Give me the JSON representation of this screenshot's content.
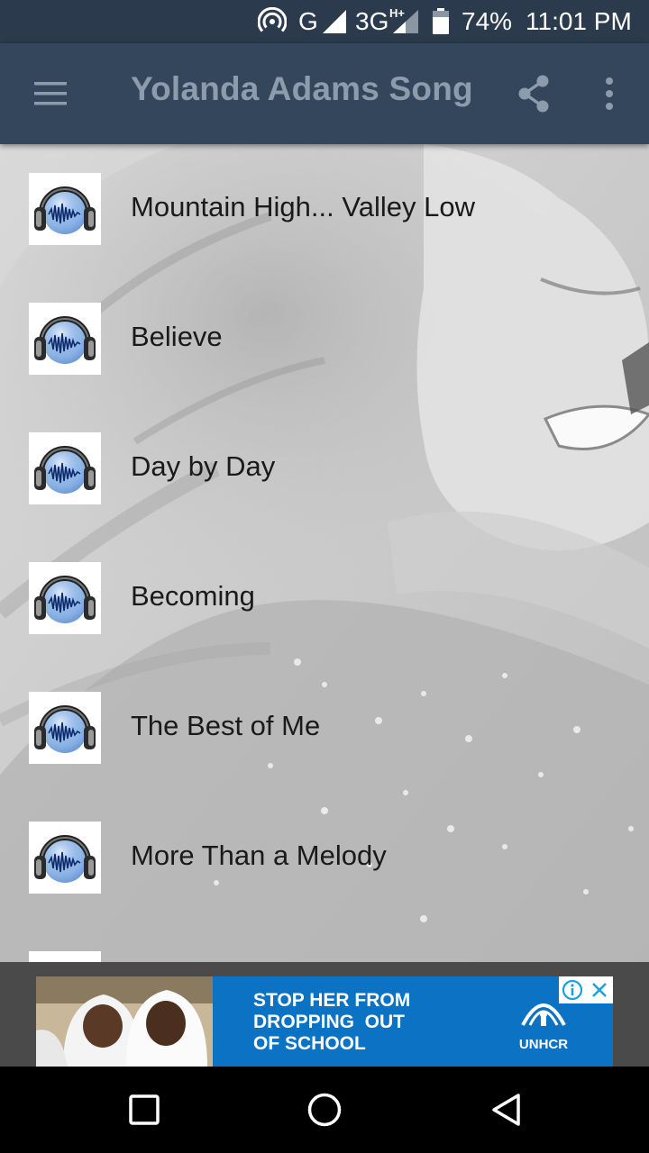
{
  "status_bar": {
    "network_g": "G",
    "network_3g": "3G",
    "network_3g_suffix": "H+",
    "battery": "74%",
    "time": "11:01 PM",
    "icons": [
      "hotspot-icon",
      "signal-icon",
      "signal-icon",
      "battery-icon"
    ]
  },
  "app_bar": {
    "title": "Yolanda Adams Song",
    "icons": [
      "menu-icon",
      "share-icon",
      "more-vert-icon"
    ]
  },
  "songs": [
    {
      "title": "Mountain High... Valley Low",
      "icon": "headphones-icon"
    },
    {
      "title": "Believe",
      "icon": "headphones-icon"
    },
    {
      "title": "Day by Day",
      "icon": "headphones-icon"
    },
    {
      "title": "Becoming",
      "icon": "headphones-icon"
    },
    {
      "title": "The Best of Me",
      "icon": "headphones-icon"
    },
    {
      "title": "More Than a Melody",
      "icon": "headphones-icon"
    },
    {
      "title": "",
      "icon": "headphones-icon"
    }
  ],
  "ad": {
    "text_line1": "STOP HER FROM",
    "text_line2": "DROPPING  OUT",
    "text_line3": "OF SCHOOL",
    "brand": "UNHCR",
    "icons": [
      "info-icon",
      "close-icon"
    ]
  },
  "nav_bar": {
    "icons": [
      "recents-icon",
      "home-icon",
      "back-icon"
    ]
  },
  "colors": {
    "status_bar": "#2b3a4d",
    "app_bar": "#34465c",
    "title_text": "#8d9cac",
    "ad_blue": "#0b72c4"
  }
}
